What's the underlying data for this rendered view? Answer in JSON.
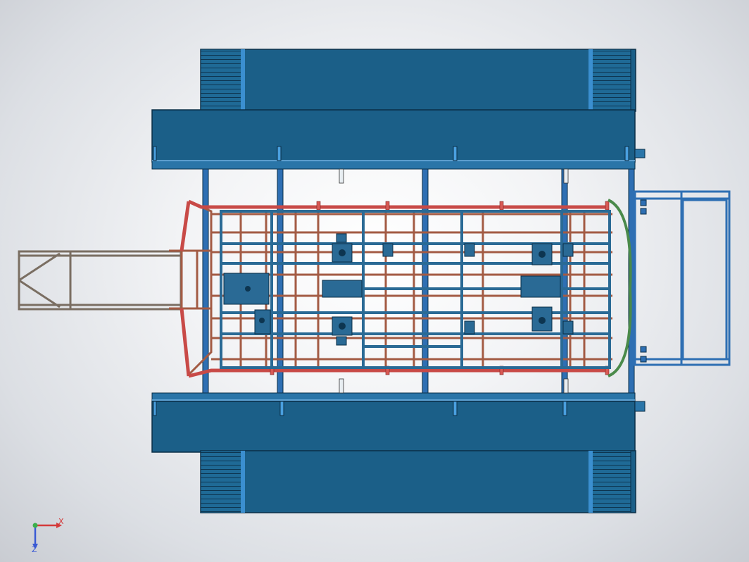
{
  "viewport": {
    "background": "light-grey-gradient",
    "model": "cad-top-view-of-vehicle-frame-on-fixture"
  },
  "colors": {
    "platform": "#1b5f88",
    "platform_edge": "#0b2f47",
    "frame_blue": "#2a6a95",
    "frame_rust": "#b4664e",
    "frame_red": "#c84a47",
    "frame_green": "#4a8a4a",
    "fixture_blue": "#2e6fb3",
    "truss_grey": "#9c8e80"
  },
  "triad": {
    "x_label": "X",
    "z_label": "Z",
    "x_color": "#d43a3a",
    "y_color": "#3ab04a",
    "z_color": "#3a5ad4"
  }
}
